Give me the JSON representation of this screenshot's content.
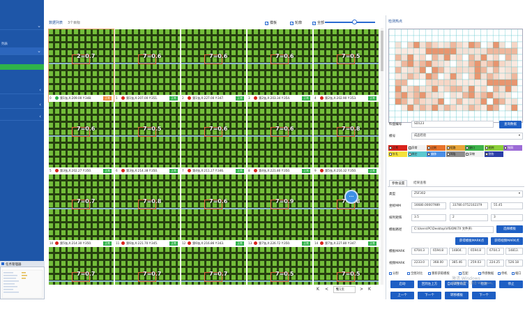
{
  "sidebar": {
    "items": [
      {
        "label": ""
      },
      {
        "label": "列表"
      },
      {
        "label": ""
      },
      {
        "label": ""
      },
      {
        "label": ""
      },
      {
        "label": ""
      }
    ],
    "thumb_title": "任务管理器"
  },
  "topbar": {
    "title": "数据列表",
    "count": "3个目标",
    "check1": "模板",
    "check2": "轮廓",
    "check3": "全部"
  },
  "tiles": [
    {
      "idx": "0",
      "label": "2=0.7",
      "cap": "第1张,X:209.00 Y:348.",
      "badge": "正常"
    },
    {
      "idx": "1",
      "label": "7=0.6",
      "cap": "第1张,X:207.00 Y:351.",
      "badge": "正常"
    },
    {
      "idx": "2",
      "label": "7=0.6",
      "cap": "第1张,X:227.00 Y:347.",
      "badge": "正常"
    },
    {
      "idx": "3",
      "label": "7=0.6",
      "cap": "第2张,X:203.34 Y:354.",
      "badge": "正常"
    },
    {
      "idx": "4",
      "label": "7=0.5",
      "cap": "第2张,X:202.90 Y:353.",
      "badge": "正常"
    },
    {
      "idx": "5",
      "label": "7=0.6",
      "cap": "第3张,X:202.27 Y:350.",
      "badge": "正常"
    },
    {
      "idx": "6",
      "label": "7=0.5",
      "cap": "第3张,X:214.38 Y:350.",
      "badge": "正常"
    },
    {
      "idx": "7",
      "label": "7=0.6",
      "cap": "第4张,X:211.27 Y:346.",
      "badge": "正常"
    },
    {
      "idx": "8",
      "label": "7=0.6",
      "cap": "第4张,X:221.80 Y:350.",
      "badge": "正常"
    },
    {
      "idx": "9",
      "label": "7=0.8",
      "cap": "第5张,X:216.32 Y:350.",
      "badge": "正常"
    },
    {
      "idx": "10",
      "label": "7=0.7",
      "cap": "第5张,X:214.30 Y:350.",
      "badge": "正常"
    },
    {
      "idx": "11",
      "label": "7=0.8",
      "cap": "第6张,X:221.70 Y:345.",
      "badge": "正常"
    },
    {
      "idx": "12",
      "label": "7=0.6",
      "cap": "第6张,X:216.86 Y:343.",
      "badge": "正常"
    },
    {
      "idx": "13",
      "label": "7=0.9",
      "cap": "第7张,X:226.72 Y:350.",
      "badge": "正常"
    },
    {
      "idx": "14",
      "label": "7=0.8",
      "cap": "第7张,X:227.80 Y:347.",
      "badge": "正常"
    },
    {
      "idx": "15",
      "label": "7=0.7",
      "cap": "",
      "badge": ""
    },
    {
      "idx": "16",
      "label": "7=0.7",
      "cap": "",
      "badge": ""
    },
    {
      "idx": "17",
      "label": "7=0.7",
      "cap": "",
      "badge": ""
    },
    {
      "idx": "18",
      "label": "7=0.5",
      "cap": "",
      "badge": ""
    },
    {
      "idx": "19",
      "label": "7=0.5",
      "cap": "",
      "badge": ""
    }
  ],
  "pager": {
    "first": "K",
    "prev": "<",
    "page": "第1页",
    "next": ">",
    "last": "K"
  },
  "right_panel": {
    "title": "检测热点",
    "row1_label": "料盘编号",
    "row1_value": "SD123",
    "row1_button": "查询数据",
    "row2_label": "模号",
    "row2_value": "成品检验",
    "tags": [
      {
        "label": "正常",
        "color": "#d9241c"
      },
      {
        "label": "异常",
        "color": "#f2f2f2"
      },
      {
        "label": "过刻",
        "color": "#e8722a"
      },
      {
        "label": "短路",
        "color": "#e8a53a"
      },
      {
        "label": "缺口",
        "color": "#3db34a"
      },
      {
        "label": "毛刺",
        "color": "#8ccf3a"
      },
      {
        "label": "残铜",
        "color": "#9c6bd6"
      },
      {
        "label": "针孔",
        "color": "#f4e23a"
      },
      {
        "label": "其它",
        "color": "#5cc9d0"
      },
      {
        "label": "偏移",
        "color": "#4b8fe6"
      },
      {
        "label": "凹陷",
        "color": "#8c8c8c"
      },
      {
        "label": "异物",
        "color": "#f2f2f2"
      },
      {
        "label": "划伤",
        "color": "#2b3ea8"
      }
    ],
    "tab1": "参数设置",
    "tab2": "结果查看",
    "f_type_label": "类型",
    "f_type_value": "ZSF302",
    "f_pos_label": "坐标MM",
    "f_pos_v1": "16680.00007989",
    "f_pos_v2": "33780.0752102379",
    "f_pos_v3": "55.45",
    "f_grid_label": "排列矩阵",
    "f_grid_v1": "3.5",
    "f_grid_v2": "2",
    "f_grid_v3": "3",
    "f_path_label": "模板路径",
    "f_path_value": "C:\\Users\\PC\\Desktop\\VISION\\TX 文件夹\\",
    "f_path_button": "选择模板",
    "btn_mark1": "获得模板MARK点",
    "btn_mark2": "获得视频MARK点",
    "f_mark_label": "模板MARK",
    "f_mark_vals": [
      "6704.3",
      "6594.8",
      "14804.",
      "6594.8",
      "6704.3",
      "14813."
    ],
    "f_vmark_label": "视频MARK",
    "f_vmark_vals": [
      "2233.0",
      "368.00",
      "385.46",
      "259.03",
      "224.25",
      "526.18"
    ],
    "checks": [
      "分割",
      "全图对比",
      "重新获取模板",
      "匹配",
      "传感数据",
      "停机",
      "缩口"
    ],
    "btn_row1": [
      "启动",
      "回到左上方",
      "自动调整角度",
      "检测",
      "停止"
    ],
    "btn_row2": [
      "上一个",
      "下一个",
      "转移模板",
      "下一个"
    ],
    "watermark_line1": "激活 Windows",
    "watermark_line2": "转到\"设置\"以激活 Windows。"
  }
}
